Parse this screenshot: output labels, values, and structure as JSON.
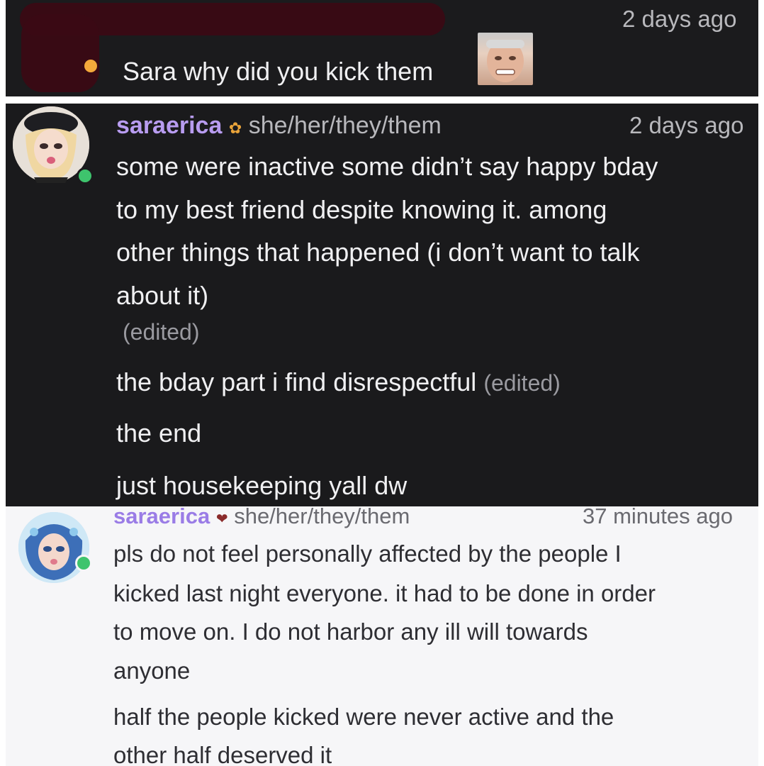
{
  "message_top": {
    "timestamp": "2 days ago",
    "text": "Sara why did you kick them",
    "status_color": "#f4a93b"
  },
  "message_mid": {
    "username": "saraerica",
    "pronouns": "she/her/they/them",
    "timestamp": "2 days ago",
    "lines": [
      "some were inactive some didn’t say happy bday",
      "to my best friend despite knowing it. among",
      "other things that happened (i don’t want to talk",
      "about it)"
    ],
    "edited_1": "(edited)",
    "line_bday": "the bday part i find disrespectful",
    "edited_2": "(edited)",
    "line_end": "the end",
    "line_house": "just housekeeping yall dw",
    "username_color": "#b89cf0",
    "status_color": "#3ec46d"
  },
  "message_bot": {
    "username": "saraerica",
    "pronouns": "she/her/they/them",
    "timestamp": "37 minutes ago",
    "lines": [
      "pls do not feel personally affected by the people I",
      "kicked last night everyone. it had to be done in order",
      "to move on. I do not harbor any ill will towards",
      "anyone"
    ],
    "lines_2": [
      "half the people kicked were never active and the",
      "other half deserved it"
    ],
    "username_color": "#9a7ce6",
    "status_color": "#3ec46d"
  }
}
